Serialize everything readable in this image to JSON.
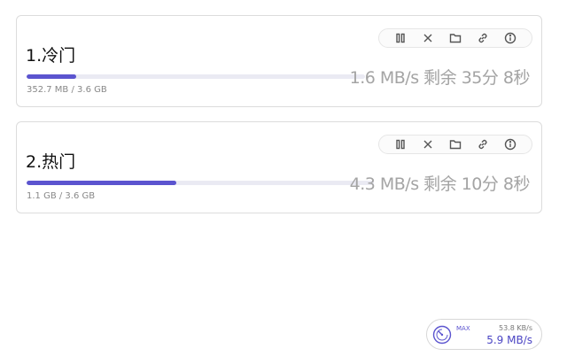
{
  "downloads": [
    {
      "title": "1.冷门",
      "progress": 0.146,
      "size": "352.7 MB / 3.6 GB",
      "speed": "1.6 MB/s 剩余 35分 8秒"
    },
    {
      "title": "2.热门",
      "progress": 0.43,
      "size": "1.1 GB / 3.6 GB",
      "speed": "4.3 MB/s 剩余 10分 8秒"
    }
  ],
  "toolbar_icons": [
    "pause-icon",
    "close-icon",
    "folder-icon",
    "link-icon",
    "info-icon"
  ],
  "speed_widget": {
    "max_label": "MAX",
    "max_value": "53.8 KB/s",
    "current": "5.9 MB/s"
  },
  "colors": {
    "accent": "#5b54cf",
    "track": "#eaeaf3",
    "speed_text": "#a4a4a4"
  }
}
